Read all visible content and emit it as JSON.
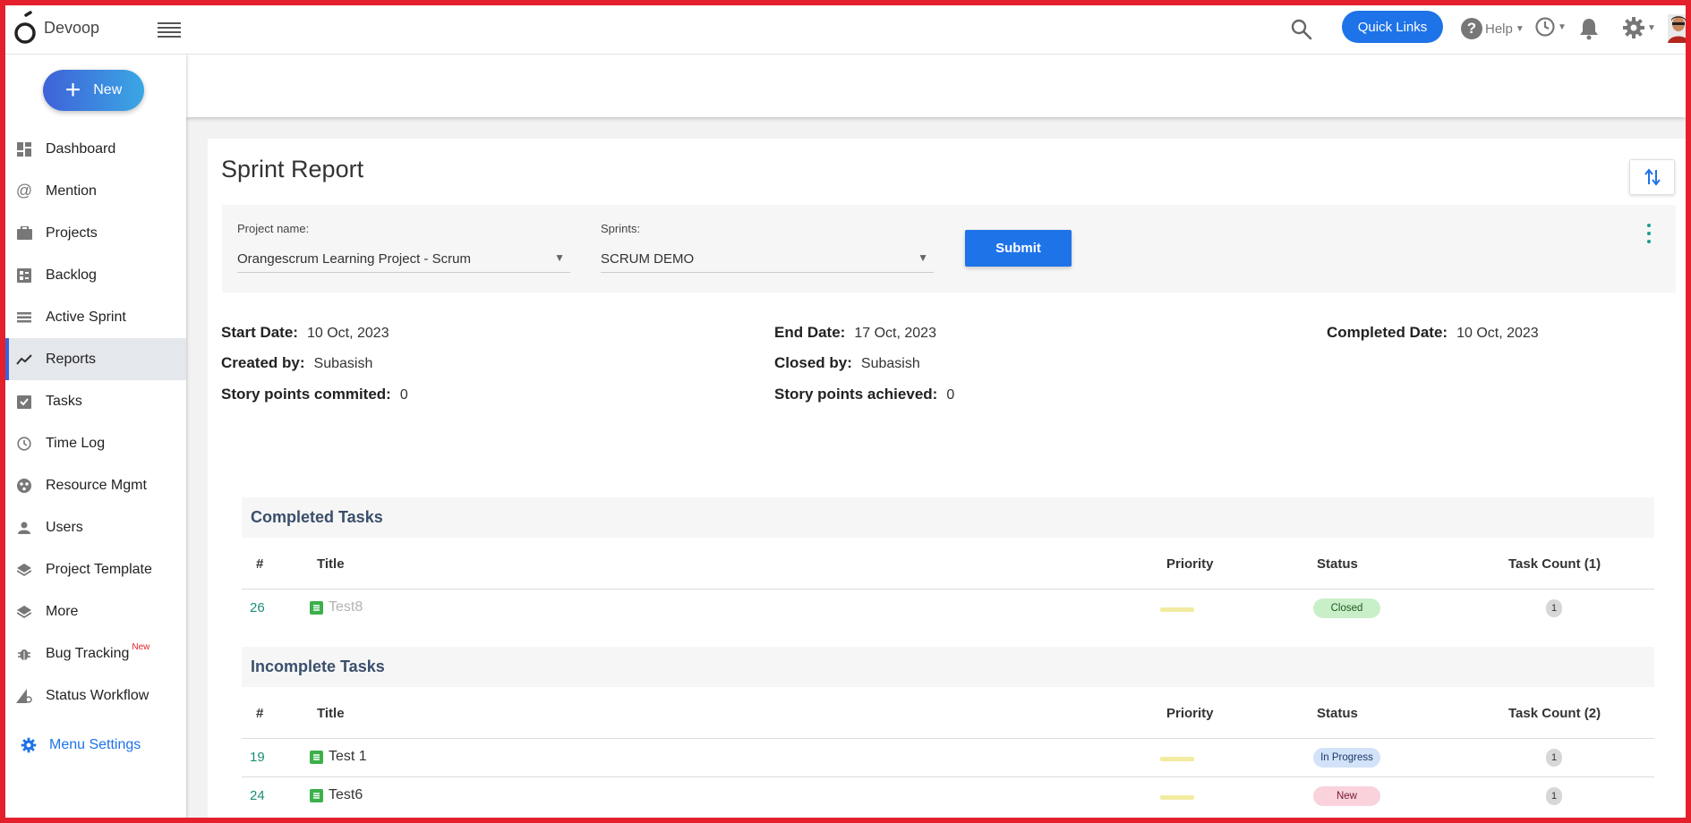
{
  "app": {
    "brand": "Devoop"
  },
  "topbar": {
    "quick_links_label": "Quick Links",
    "help_label": "Help"
  },
  "sidebar": {
    "new_label": "New",
    "items": [
      {
        "label": "Dashboard",
        "icon": "dashboard-icon"
      },
      {
        "label": "Mention",
        "icon": "at-icon"
      },
      {
        "label": "Projects",
        "icon": "briefcase-icon"
      },
      {
        "label": "Backlog",
        "icon": "backlog-icon"
      },
      {
        "label": "Active Sprint",
        "icon": "sprint-icon"
      },
      {
        "label": "Reports",
        "icon": "chart-line-icon",
        "active": true
      },
      {
        "label": "Tasks",
        "icon": "task-check-icon"
      },
      {
        "label": "Time Log",
        "icon": "clock-icon"
      },
      {
        "label": "Resource Mgmt",
        "icon": "resource-icon"
      },
      {
        "label": "Users",
        "icon": "user-icon"
      },
      {
        "label": "Project Template",
        "icon": "layers-icon"
      },
      {
        "label": "More",
        "icon": "layers-icon"
      },
      {
        "label": "Bug Tracking",
        "icon": "bug-icon",
        "tag": "New"
      },
      {
        "label": "Status Workflow",
        "icon": "workflow-icon"
      }
    ],
    "menu_settings_label": "Menu Settings"
  },
  "page": {
    "title": "Sprint Report",
    "filters": {
      "project_label": "Project name:",
      "project_value": "Orangescrum Learning Project - Scrum",
      "sprint_label": "Sprints:",
      "sprint_value": "SCRUM DEMO",
      "submit_label": "Submit"
    },
    "info": {
      "start_label": "Start Date:",
      "start_value": "10 Oct, 2023",
      "end_label": "End Date:",
      "end_value": "17 Oct, 2023",
      "completed_label": "Completed Date:",
      "completed_value": "10 Oct, 2023",
      "created_label": "Created by:",
      "created_value": "Subasish",
      "closed_label": "Closed by:",
      "closed_value": "Subasish",
      "committed_label": "Story points commited:",
      "committed_value": "0",
      "achieved_label": "Story points achieved:",
      "achieved_value": "0"
    }
  },
  "completed_tasks": {
    "title": "Completed Tasks",
    "headers": {
      "num": "#",
      "title": "Title",
      "priority": "Priority",
      "status": "Status",
      "count": "Task Count (1)"
    },
    "rows": [
      {
        "num": "26",
        "title": "Test8",
        "status": "Closed",
        "count": "1"
      }
    ]
  },
  "incomplete_tasks": {
    "title": "Incomplete Tasks",
    "headers": {
      "num": "#",
      "title": "Title",
      "priority": "Priority",
      "status": "Status",
      "count": "Task Count (2)"
    },
    "rows": [
      {
        "num": "19",
        "title": "Test 1",
        "status": "In Progress",
        "count": "1"
      },
      {
        "num": "24",
        "title": "Test6",
        "status": "New",
        "count": "1"
      }
    ]
  },
  "colors": {
    "accent": "#1e73e8",
    "frame": "#e3202c",
    "status_closed_bg": "#c9efc9",
    "status_inprogress_bg": "#d2e2f8",
    "status_new_bg": "#f9d2dc"
  }
}
